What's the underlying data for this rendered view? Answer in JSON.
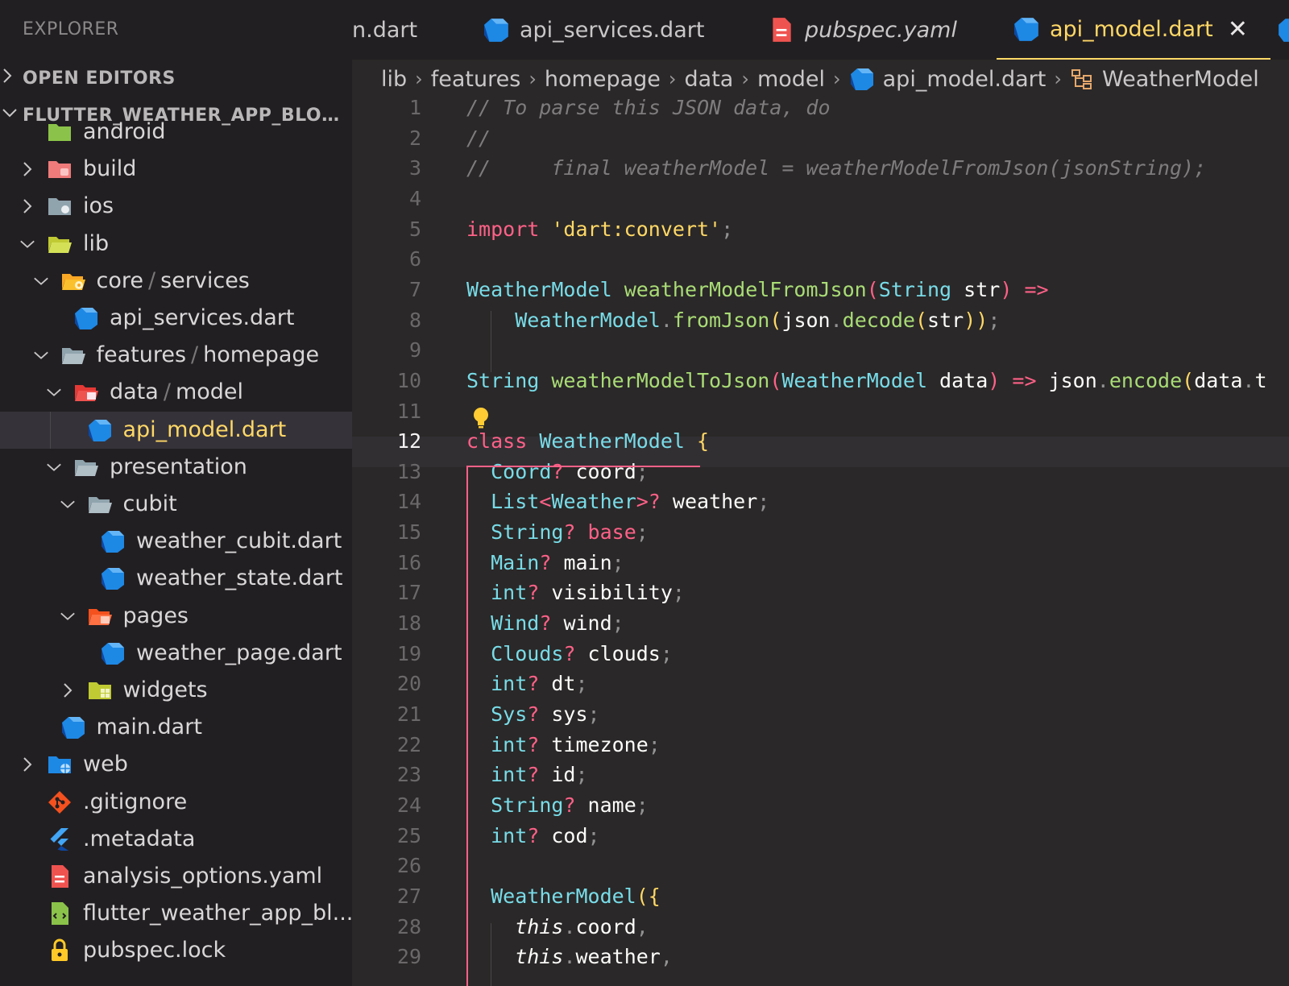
{
  "sidebar": {
    "title": "EXPLORER",
    "open_editors": "OPEN EDITORS",
    "project": "FLUTTER_WEATHER_APP_BLOC...",
    "tree": [
      {
        "label": "android",
        "depth": 0,
        "twisty": "none",
        "icon": "android-folder-icon",
        "partial": true
      },
      {
        "label": "build",
        "depth": 0,
        "twisty": "right",
        "icon": "build-folder-icon"
      },
      {
        "label": "ios",
        "depth": 0,
        "twisty": "right",
        "icon": "ios-folder-icon"
      },
      {
        "label": "lib",
        "depth": 0,
        "twisty": "down",
        "icon": "lib-folder-icon"
      },
      {
        "label": "core",
        "label2": "services",
        "depth": 1,
        "twisty": "down",
        "icon": "core-folder-icon"
      },
      {
        "label": "api_services.dart",
        "depth": 2,
        "twisty": "none",
        "icon": "dart-file-icon"
      },
      {
        "label": "features",
        "label2": "homepage",
        "depth": 1,
        "twisty": "down",
        "icon": "folder-open-icon"
      },
      {
        "label": "data",
        "label2": "model",
        "depth": 2,
        "twisty": "down",
        "icon": "data-folder-icon"
      },
      {
        "label": "api_model.dart",
        "depth": 3,
        "twisty": "none",
        "icon": "dart-file-icon",
        "selected": true
      },
      {
        "label": "presentation",
        "depth": 2,
        "twisty": "down",
        "icon": "folder-open-icon"
      },
      {
        "label": "cubit",
        "depth": 3,
        "twisty": "down",
        "icon": "folder-open-icon"
      },
      {
        "label": "weather_cubit.dart",
        "depth": 4,
        "twisty": "none",
        "icon": "dart-file-icon"
      },
      {
        "label": "weather_state.dart",
        "depth": 4,
        "twisty": "none",
        "icon": "dart-file-icon"
      },
      {
        "label": "pages",
        "depth": 3,
        "twisty": "down",
        "icon": "pages-folder-icon"
      },
      {
        "label": "weather_page.dart",
        "depth": 4,
        "twisty": "none",
        "icon": "dart-file-icon"
      },
      {
        "label": "widgets",
        "depth": 3,
        "twisty": "right",
        "icon": "widgets-folder-icon"
      },
      {
        "label": "main.dart",
        "depth": 1,
        "twisty": "none",
        "icon": "dart-file-icon"
      },
      {
        "label": "web",
        "depth": 0,
        "twisty": "right",
        "icon": "web-folder-icon"
      },
      {
        "label": ".gitignore",
        "depth": 0,
        "twisty": "none",
        "icon": "git-icon"
      },
      {
        "label": ".metadata",
        "depth": 0,
        "twisty": "none",
        "icon": "flutter-icon"
      },
      {
        "label": "analysis_options.yaml",
        "depth": 0,
        "twisty": "none",
        "icon": "yaml-file-icon"
      },
      {
        "label": "flutter_weather_app_bl...",
        "depth": 0,
        "twisty": "none",
        "icon": "iml-file-icon"
      },
      {
        "label": "pubspec.lock",
        "depth": 0,
        "twisty": "none",
        "icon": "lock-icon"
      }
    ]
  },
  "tabs": [
    {
      "label": "n.dart",
      "icon": "none"
    },
    {
      "label": "api_services.dart",
      "icon": "dart-file-icon"
    },
    {
      "label": "pubspec.yaml",
      "icon": "yaml-file-icon",
      "italic": true
    },
    {
      "label": "api_model.dart",
      "icon": "dart-file-icon",
      "active": true,
      "close": "✕"
    }
  ],
  "breadcrumb": [
    "lib",
    "features",
    "homepage",
    "data",
    "model",
    "api_model.dart",
    "WeatherModel"
  ],
  "editor": {
    "active_line": 12,
    "lines": [
      [
        [
          "cm",
          "// To parse this JSON data, do"
        ]
      ],
      [
        [
          "cm",
          "//"
        ]
      ],
      [
        [
          "cm",
          "//     final weatherModel = weatherModelFromJson(jsonString);"
        ]
      ],
      [],
      [
        [
          "kw",
          "import"
        ],
        [
          "id",
          " "
        ],
        [
          "str",
          "'dart:convert'"
        ],
        [
          "pu",
          ";"
        ]
      ],
      [],
      [
        [
          "ty",
          "WeatherModel"
        ],
        [
          "id",
          " "
        ],
        [
          "fn",
          "weatherModelFromJson"
        ],
        [
          "kw",
          "("
        ],
        [
          "ty",
          "String"
        ],
        [
          "id",
          " str"
        ],
        [
          "kw",
          ")"
        ],
        [
          "id",
          " "
        ],
        [
          "kw",
          "=>"
        ]
      ],
      [
        [
          "id",
          "    "
        ],
        [
          "ty",
          "WeatherModel"
        ],
        [
          "pu",
          "."
        ],
        [
          "fn",
          "fromJson"
        ],
        [
          "br",
          "("
        ],
        [
          "id",
          "json"
        ],
        [
          "pu",
          "."
        ],
        [
          "fn",
          "decode"
        ],
        [
          "br",
          "("
        ],
        [
          "id",
          "str"
        ],
        [
          "br",
          "))"
        ],
        [
          "pu",
          ";"
        ]
      ],
      [],
      [
        [
          "ty",
          "String"
        ],
        [
          "id",
          " "
        ],
        [
          "fn",
          "weatherModelToJson"
        ],
        [
          "kw",
          "("
        ],
        [
          "ty",
          "WeatherModel"
        ],
        [
          "id",
          " data"
        ],
        [
          "kw",
          ")"
        ],
        [
          "id",
          " "
        ],
        [
          "kw",
          "=>"
        ],
        [
          "id",
          " json"
        ],
        [
          "pu",
          "."
        ],
        [
          "fn",
          "encode"
        ],
        [
          "br",
          "("
        ],
        [
          "id",
          "data"
        ],
        [
          "pu",
          "."
        ],
        [
          "id",
          "t"
        ]
      ],
      [],
      [
        [
          "kw",
          "class"
        ],
        [
          "id",
          " "
        ],
        [
          "ty",
          "WeatherModel"
        ],
        [
          "id",
          " "
        ],
        [
          "br",
          "{"
        ]
      ],
      [
        [
          "id",
          "  "
        ],
        [
          "ty",
          "Coord"
        ],
        [
          "kw",
          "?"
        ],
        [
          "id",
          " coord"
        ],
        [
          "pu",
          ";"
        ]
      ],
      [
        [
          "id",
          "  "
        ],
        [
          "ty",
          "List"
        ],
        [
          "kw",
          "<"
        ],
        [
          "ty",
          "Weather"
        ],
        [
          "kw",
          ">?"
        ],
        [
          "id",
          " weather"
        ],
        [
          "pu",
          ";"
        ]
      ],
      [
        [
          "id",
          "  "
        ],
        [
          "ty",
          "String"
        ],
        [
          "kw",
          "?"
        ],
        [
          "id",
          " "
        ],
        [
          "kw",
          "base"
        ],
        [
          "pu",
          ";"
        ]
      ],
      [
        [
          "id",
          "  "
        ],
        [
          "ty",
          "Main"
        ],
        [
          "kw",
          "?"
        ],
        [
          "id",
          " main"
        ],
        [
          "pu",
          ";"
        ]
      ],
      [
        [
          "id",
          "  "
        ],
        [
          "ty",
          "int"
        ],
        [
          "kw",
          "?"
        ],
        [
          "id",
          " visibility"
        ],
        [
          "pu",
          ";"
        ]
      ],
      [
        [
          "id",
          "  "
        ],
        [
          "ty",
          "Wind"
        ],
        [
          "kw",
          "?"
        ],
        [
          "id",
          " wind"
        ],
        [
          "pu",
          ";"
        ]
      ],
      [
        [
          "id",
          "  "
        ],
        [
          "ty",
          "Clouds"
        ],
        [
          "kw",
          "?"
        ],
        [
          "id",
          " clouds"
        ],
        [
          "pu",
          ";"
        ]
      ],
      [
        [
          "id",
          "  "
        ],
        [
          "ty",
          "int"
        ],
        [
          "kw",
          "?"
        ],
        [
          "id",
          " dt"
        ],
        [
          "pu",
          ";"
        ]
      ],
      [
        [
          "id",
          "  "
        ],
        [
          "ty",
          "Sys"
        ],
        [
          "kw",
          "?"
        ],
        [
          "id",
          " sys"
        ],
        [
          "pu",
          ";"
        ]
      ],
      [
        [
          "id",
          "  "
        ],
        [
          "ty",
          "int"
        ],
        [
          "kw",
          "?"
        ],
        [
          "id",
          " timezone"
        ],
        [
          "pu",
          ";"
        ]
      ],
      [
        [
          "id",
          "  "
        ],
        [
          "ty",
          "int"
        ],
        [
          "kw",
          "?"
        ],
        [
          "id",
          " id"
        ],
        [
          "pu",
          ";"
        ]
      ],
      [
        [
          "id",
          "  "
        ],
        [
          "ty",
          "String"
        ],
        [
          "kw",
          "?"
        ],
        [
          "id",
          " name"
        ],
        [
          "pu",
          ";"
        ]
      ],
      [
        [
          "id",
          "  "
        ],
        [
          "ty",
          "int"
        ],
        [
          "kw",
          "?"
        ],
        [
          "id",
          " cod"
        ],
        [
          "pu",
          ";"
        ]
      ],
      [],
      [
        [
          "id",
          "  "
        ],
        [
          "ty",
          "WeatherModel"
        ],
        [
          "br",
          "({"
        ]
      ],
      [
        [
          "id",
          "    "
        ],
        [
          "this",
          "this"
        ],
        [
          "pu",
          "."
        ],
        [
          "id",
          "coord"
        ],
        [
          "pu",
          ","
        ]
      ],
      [
        [
          "id",
          "    "
        ],
        [
          "this",
          "this"
        ],
        [
          "pu",
          "."
        ],
        [
          "id",
          "weather"
        ],
        [
          "pu",
          ","
        ]
      ]
    ]
  },
  "colors": {
    "accent": "#ffd866",
    "keyword": "#ff6188",
    "type": "#78dce8",
    "function": "#a9dc76",
    "comment": "#7f7c7d",
    "dart_blue": "#1e88e5"
  }
}
